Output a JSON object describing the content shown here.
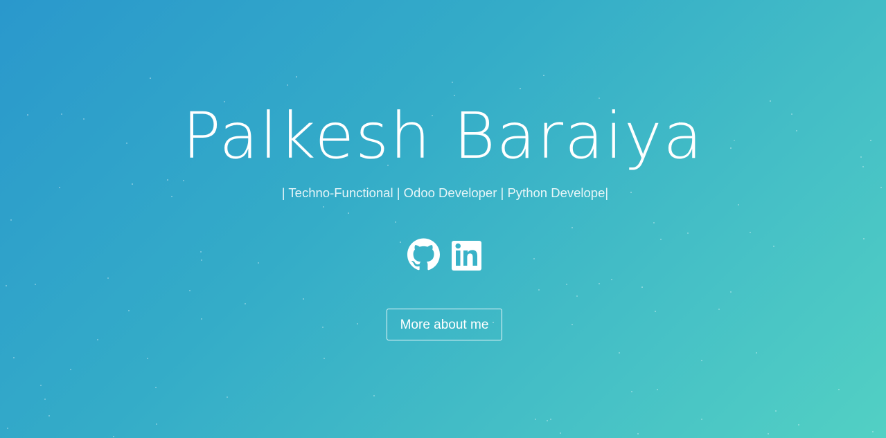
{
  "hero": {
    "title": "Palkesh Baraiya",
    "subtitle": "| Techno-Functional | Odoo Developer | Python Develope|",
    "button_label": "More about me"
  },
  "social": {
    "items": [
      {
        "icon": "github-icon"
      },
      {
        "icon": "linkedin-icon"
      }
    ]
  },
  "colors": {
    "gradient_start": "#2a98cc",
    "gradient_end": "#52d0c4",
    "text": "#ffffff"
  }
}
